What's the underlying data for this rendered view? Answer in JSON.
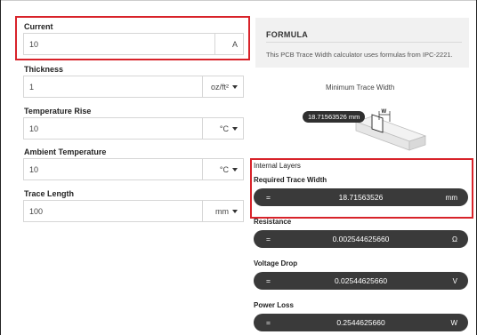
{
  "inputs": {
    "current": {
      "label": "Current",
      "value": "10",
      "unit": "A"
    },
    "thickness": {
      "label": "Thickness",
      "value": "1",
      "unit": "oz/ft²"
    },
    "temperature_rise": {
      "label": "Temperature Rise",
      "value": "10",
      "unit": "°C"
    },
    "ambient_temperature": {
      "label": "Ambient Temperature",
      "value": "10",
      "unit": "°C"
    },
    "trace_length": {
      "label": "Trace Length",
      "value": "100",
      "unit": "mm"
    }
  },
  "formula": {
    "title": "FORMULA",
    "description": "This PCB Trace Width calculator uses formulas from IPC-2221."
  },
  "diagram": {
    "title": "Minimum Trace Width",
    "tooltip_value": "18.71563526 mm",
    "width_marker": "W"
  },
  "results": {
    "layer": "Internal Layers",
    "equals_sign": "=",
    "required_trace_width": {
      "label": "Required Trace Width",
      "value": "18.71563526",
      "unit": "mm"
    },
    "resistance": {
      "label": "Resistance",
      "value": "0.002544625660",
      "unit": "Ω"
    },
    "voltage_drop": {
      "label": "Voltage Drop",
      "value": "0.02544625660",
      "unit": "V"
    },
    "power_loss": {
      "label": "Power Loss",
      "value": "0.2544625660",
      "unit": "W"
    }
  },
  "colors": {
    "highlight": "#d8232a",
    "pill_background": "#3a3a3a",
    "formula_card_background": "#f1f1f1"
  }
}
